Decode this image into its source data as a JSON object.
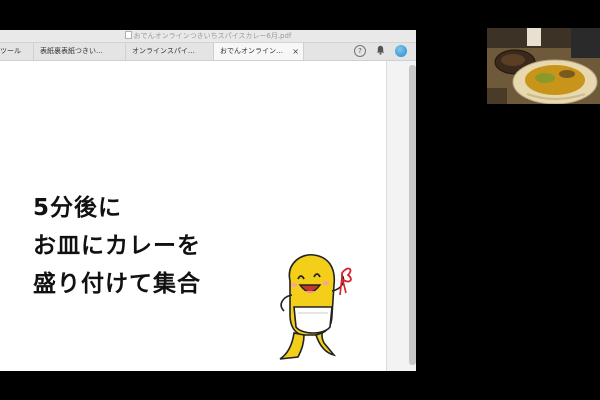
{
  "window": {
    "title": "おでんオンラインつきいちスパイスカレー6月.pdf"
  },
  "tabs": [
    {
      "label": "ツール"
    },
    {
      "label": "表紙裏表紙つきい…"
    },
    {
      "label": "オンラインスパイ…"
    },
    {
      "label": "おでんオンライン…",
      "active": true,
      "close": "×"
    }
  ],
  "toolbar": {
    "help": "?",
    "bell": "🔔"
  },
  "slide": {
    "lines": [
      "5分後に",
      "お皿にカレーを",
      "盛り付けて集合"
    ]
  },
  "icons": {
    "cursor": "pointer-hand-icon",
    "mascot": "oden-mascot-illustration",
    "webcam": "curry-dish-webcam"
  },
  "colors": {
    "mascot_yellow": "#f4cf1a",
    "bow_red": "#d6202a",
    "background": "#000000"
  }
}
